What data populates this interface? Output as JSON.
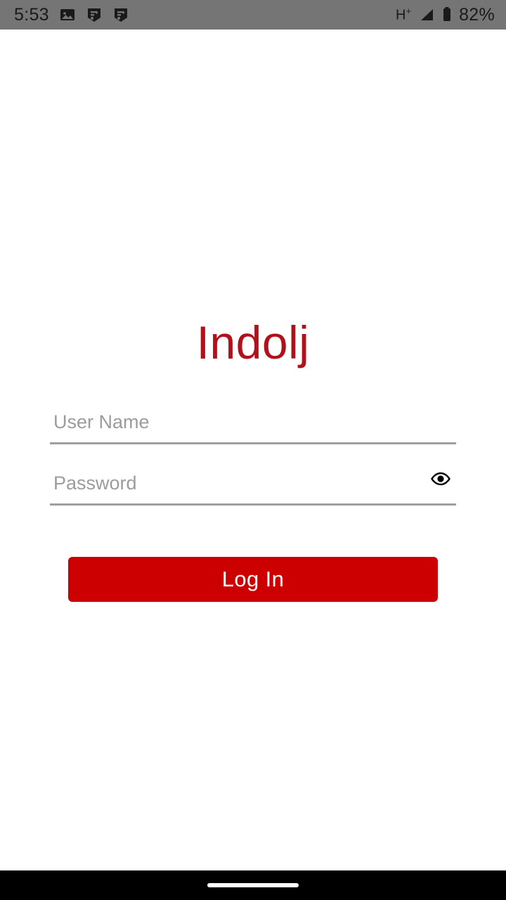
{
  "status_bar": {
    "time": "5:53",
    "network_type": "H",
    "network_type_sup": "+",
    "battery_percent": "82%",
    "background_color": "#757575",
    "foreground_color": "#1a1a1a",
    "left_icons": [
      {
        "name": "image-icon"
      },
      {
        "name": "notification-badge-icon-1"
      },
      {
        "name": "notification-badge-icon-2"
      }
    ],
    "right_icons": [
      {
        "name": "signal-bars-icon"
      },
      {
        "name": "battery-icon"
      }
    ]
  },
  "login": {
    "brand": "Indolj",
    "brand_color": "#b0111a",
    "username": {
      "placeholder": "User Name",
      "value": ""
    },
    "password": {
      "placeholder": "Password",
      "value": "",
      "toggle_icon": "eye-icon",
      "visible": false
    },
    "submit_label": "Log In",
    "submit_color": "#cc0000",
    "submit_text_color": "#ffffff",
    "underline_color": "#9e9e9e",
    "placeholder_color": "#9c9c9c"
  },
  "nav_bar": {
    "background_color": "#000000",
    "home_indicator_color": "#ffffff"
  }
}
